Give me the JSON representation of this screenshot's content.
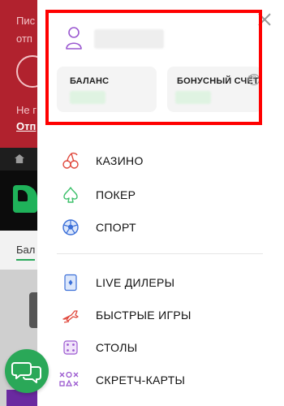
{
  "background": {
    "red_line1": "Пис",
    "red_line2": "отп",
    "red_line3": "Не г",
    "red_line4": "Отп",
    "balance_tab": "Бал"
  },
  "drawer": {
    "cards": {
      "balance_label": "БАЛАНС",
      "bonus_label": "БОНУСНЫЙ СЧЁТ",
      "help_glyph": "?"
    },
    "menu_group1": [
      {
        "label": "КАЗИНО",
        "icon": "cherries-icon"
      },
      {
        "label": "ПОКЕР",
        "icon": "spade-icon"
      },
      {
        "label": "СПОРТ",
        "icon": "soccer-ball-icon"
      }
    ],
    "menu_group2": [
      {
        "label": "LIVE ДИЛЕРЫ",
        "icon": "card-icon"
      },
      {
        "label": "БЫСТРЫЕ ИГРЫ",
        "icon": "airplane-icon"
      },
      {
        "label": "СТОЛЫ",
        "icon": "dice-icon"
      },
      {
        "label": "СКРЕТЧ-КАРТЫ",
        "icon": "scratch-card-icon"
      }
    ]
  },
  "colors": {
    "accent_red": "#ff0000",
    "brand_green": "#2aa858",
    "icon_purple": "#9b59d0",
    "icon_red": "#e0483c",
    "icon_green": "#3cc06a",
    "icon_blue": "#3b6fd8"
  }
}
